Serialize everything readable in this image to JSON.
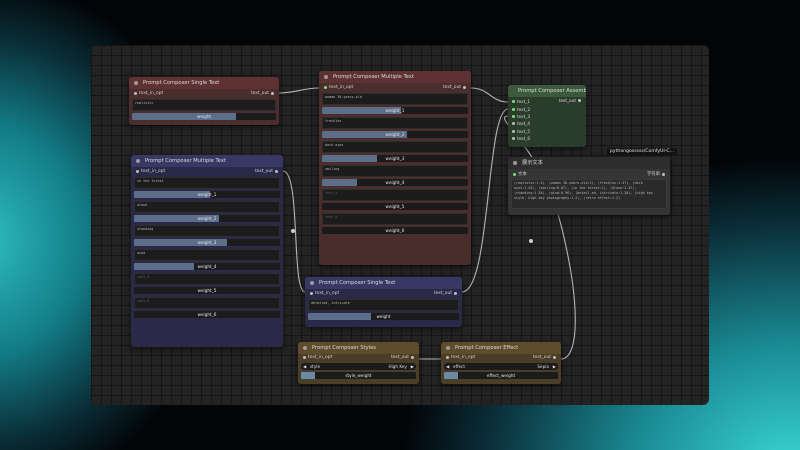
{
  "nodes": {
    "single_top": {
      "title": "Prompt Composer Single Text",
      "in": "text_in_opt",
      "out": "text_out",
      "text": "realistic",
      "slider": {
        "label": "weight",
        "value": 0.72
      }
    },
    "multi_red": {
      "title": "Prompt Composer Multiple Text",
      "in": "text_in_opt",
      "out": "text_out",
      "texts": [
        "woman 30-years-old",
        "freckles",
        "dark eyes",
        "smiling",
        "text_5",
        "text_6"
      ],
      "sliders": [
        {
          "label": "weight_1",
          "value": 0.54
        },
        {
          "label": "weight_2",
          "value": 0.58
        },
        {
          "label": "weight_3",
          "value": 0.38
        },
        {
          "label": "weight_4",
          "value": 0.24
        },
        {
          "label": "weight_5",
          "value": 0
        },
        {
          "label": "weight_6",
          "value": 0
        }
      ]
    },
    "multi_blue": {
      "title": "Prompt Composer Multiple Text",
      "in": "text_in_opt",
      "out": "text_out",
      "texts": [
        "in the forest",
        "alone",
        "standing",
        "wind",
        "text_5",
        "text_6"
      ],
      "sliders": [
        {
          "label": "weight_1",
          "value": 0.52
        },
        {
          "label": "weight_2",
          "value": 0.58
        },
        {
          "label": "weight_3",
          "value": 0.64
        },
        {
          "label": "weight_4",
          "value": 0.41
        },
        {
          "label": "weight_5",
          "value": 0
        },
        {
          "label": "weight_6",
          "value": 0
        }
      ]
    },
    "single_bottom": {
      "title": "Prompt Composer Single Text",
      "in": "text_in_opt",
      "out": "text_out",
      "text": "detailed, intricate",
      "slider": {
        "label": "weight",
        "value": 0.42
      }
    },
    "assembler": {
      "title": "Prompt Composer Assembler",
      "inputs": [
        "text_1",
        "text_2",
        "text_3",
        "text_4",
        "text_5",
        "text_6"
      ],
      "out": "text_out"
    },
    "display": {
      "tooltip": "pythongosssss/ComfyUI-C...",
      "title": "展示文本",
      "in": "文本",
      "out": "字符串",
      "text": "(realistic:1.4), (woman 30-years-old:1), (freckles:1.57), (dark eyes:1.43), (smiling:0.87), (in the forest:1), (alone:1.47), (standing:1.54), (wind:0.96), (detail ed, intricate:1.28), (high key style, high key photography:1.2), (retro effect:1.2)"
    },
    "styles": {
      "title": "Prompt Composer Styles",
      "in": "text_in_opt",
      "out": "text_out",
      "combo": {
        "label": "style",
        "value": "High Key"
      },
      "slider": {
        "label": "style_weight",
        "value": 0.12
      }
    },
    "effect": {
      "title": "Prompt Composer Effect",
      "in": "text_in_opt",
      "out": "text_out",
      "combo": {
        "label": "effect",
        "value": "Sepia"
      },
      "slider": {
        "label": "effect_weight",
        "value": 0.12
      }
    }
  },
  "colors": {
    "red_node": "#5e3232",
    "blue_node": "#383865",
    "green_node": "#3b5a3b",
    "gold_node": "#5e4c2a",
    "wire": "#c8c8c8"
  }
}
